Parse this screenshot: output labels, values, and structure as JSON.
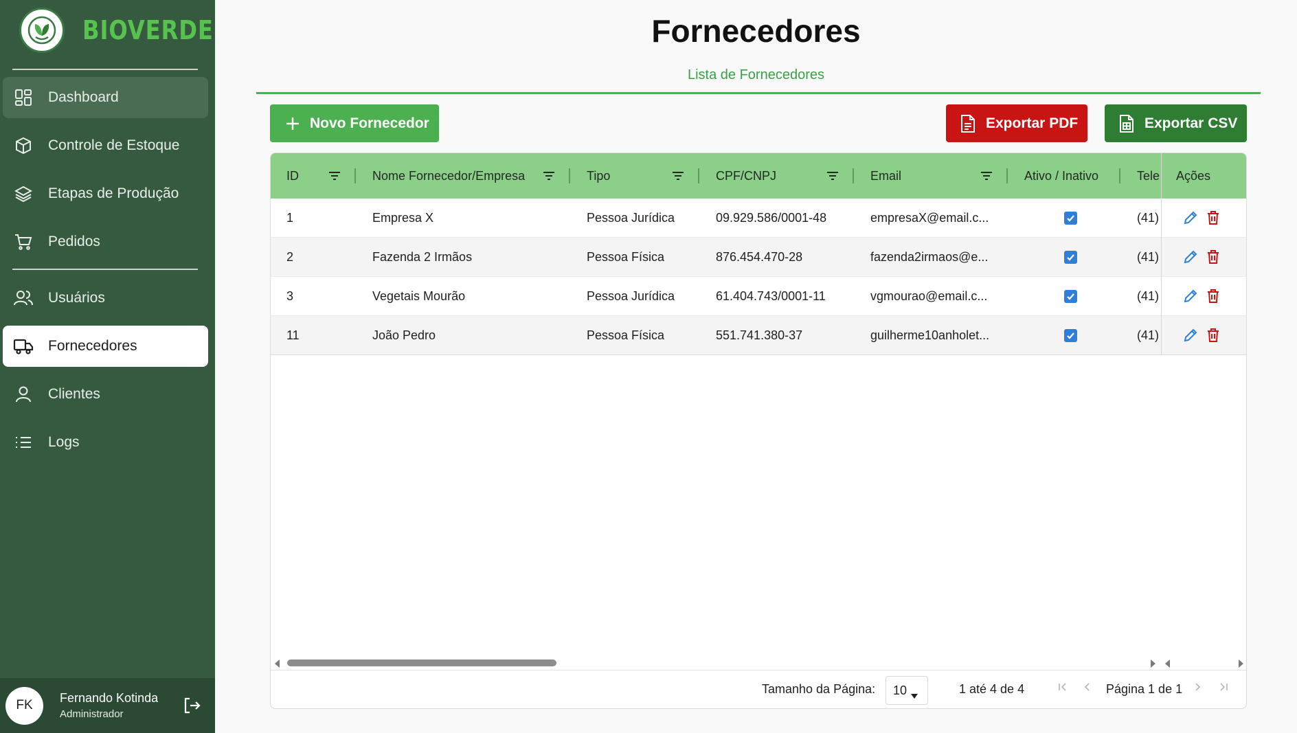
{
  "brand": {
    "name": "BIOVERDE"
  },
  "sidebar": {
    "items": [
      {
        "label": "Dashboard",
        "icon": "dashboard-icon"
      },
      {
        "label": "Controle de Estoque",
        "icon": "box-icon"
      },
      {
        "label": "Etapas de Produção",
        "icon": "layers-icon"
      },
      {
        "label": "Pedidos",
        "icon": "cart-icon"
      },
      {
        "label": "Usuários",
        "icon": "users-icon"
      },
      {
        "label": "Fornecedores",
        "icon": "truck-icon"
      },
      {
        "label": "Clientes",
        "icon": "user-icon"
      },
      {
        "label": "Logs",
        "icon": "list-icon"
      }
    ],
    "active": "Fornecedores"
  },
  "user": {
    "initials": "FK",
    "name": "Fernando Kotinda",
    "role": "Administrador"
  },
  "page": {
    "title": "Fornecedores",
    "subtitle": "Lista de Fornecedores"
  },
  "toolbar": {
    "new_label": "Novo Fornecedor",
    "pdf_label": "Exportar PDF",
    "csv_label": "Exportar CSV"
  },
  "table": {
    "columns": [
      "ID",
      "Nome Fornecedor/Empresa",
      "Tipo",
      "CPF/CNPJ",
      "Email",
      "Ativo / Inativo",
      "Tele",
      "Ações"
    ],
    "rows": [
      {
        "id": "1",
        "name": "Empresa X",
        "tipo": "Pessoa Jurídica",
        "doc": "09.929.586/0001-48",
        "email": "empresaX@email.c...",
        "ativo": true,
        "tel": "(41)"
      },
      {
        "id": "2",
        "name": "Fazenda 2 Irmãos",
        "tipo": "Pessoa Física",
        "doc": "876.454.470-28",
        "email": "fazenda2irmaos@e...",
        "ativo": true,
        "tel": "(41)"
      },
      {
        "id": "3",
        "name": "Vegetais Mourão",
        "tipo": "Pessoa Jurídica",
        "doc": "61.404.743/0001-11",
        "email": "vgmourao@email.c...",
        "ativo": true,
        "tel": "(41)"
      },
      {
        "id": "11",
        "name": "João Pedro",
        "tipo": "Pessoa Física",
        "doc": "551.741.380-37",
        "email": "guilherme10anholet...",
        "ativo": true,
        "tel": "(41)"
      }
    ]
  },
  "pagination": {
    "size_label": "Tamanho da Página:",
    "size_value": "10",
    "range": "1 até 4 de 4",
    "page": "Página 1 de 1"
  },
  "colors": {
    "sidebar": "#355a40",
    "accent": "#4caf50",
    "pdf": "#c91414",
    "csv": "#2e7d32",
    "header": "#8bcf88"
  }
}
